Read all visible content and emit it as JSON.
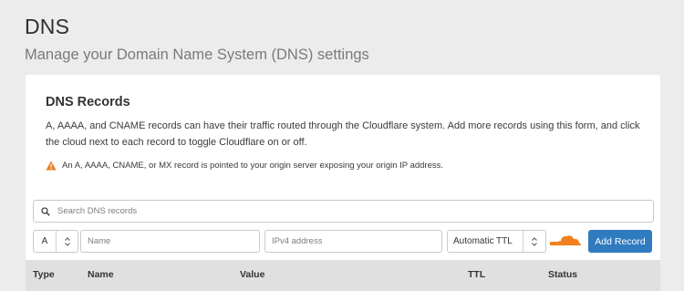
{
  "page": {
    "title": "DNS",
    "subtitle": "Manage your Domain Name System (DNS) settings"
  },
  "card": {
    "title": "DNS Records",
    "description": "A, AAAA, and CNAME records can have their traffic routed through the Cloudflare system. Add more records using this form, and click the cloud next to each record to toggle Cloudflare on or off.",
    "warning": "An A, AAAA, CNAME, or MX record is pointed to your origin server exposing your origin IP address."
  },
  "search": {
    "placeholder": "Search DNS records",
    "icon": "search-icon"
  },
  "form": {
    "type_value": "A",
    "name_placeholder": "Name",
    "address_placeholder": "IPv4 address",
    "ttl_value": "Automatic TTL",
    "add_label": "Add Record",
    "cloud_icon": "cloud-proxy-toggle-icon",
    "cloud_color": "#f38020",
    "button_color": "#2f7bbf"
  },
  "table": {
    "columns": [
      "Type",
      "Name",
      "Value",
      "TTL",
      "Status"
    ]
  },
  "colors": {
    "warning": "#e67e22",
    "background": "#ececec"
  }
}
